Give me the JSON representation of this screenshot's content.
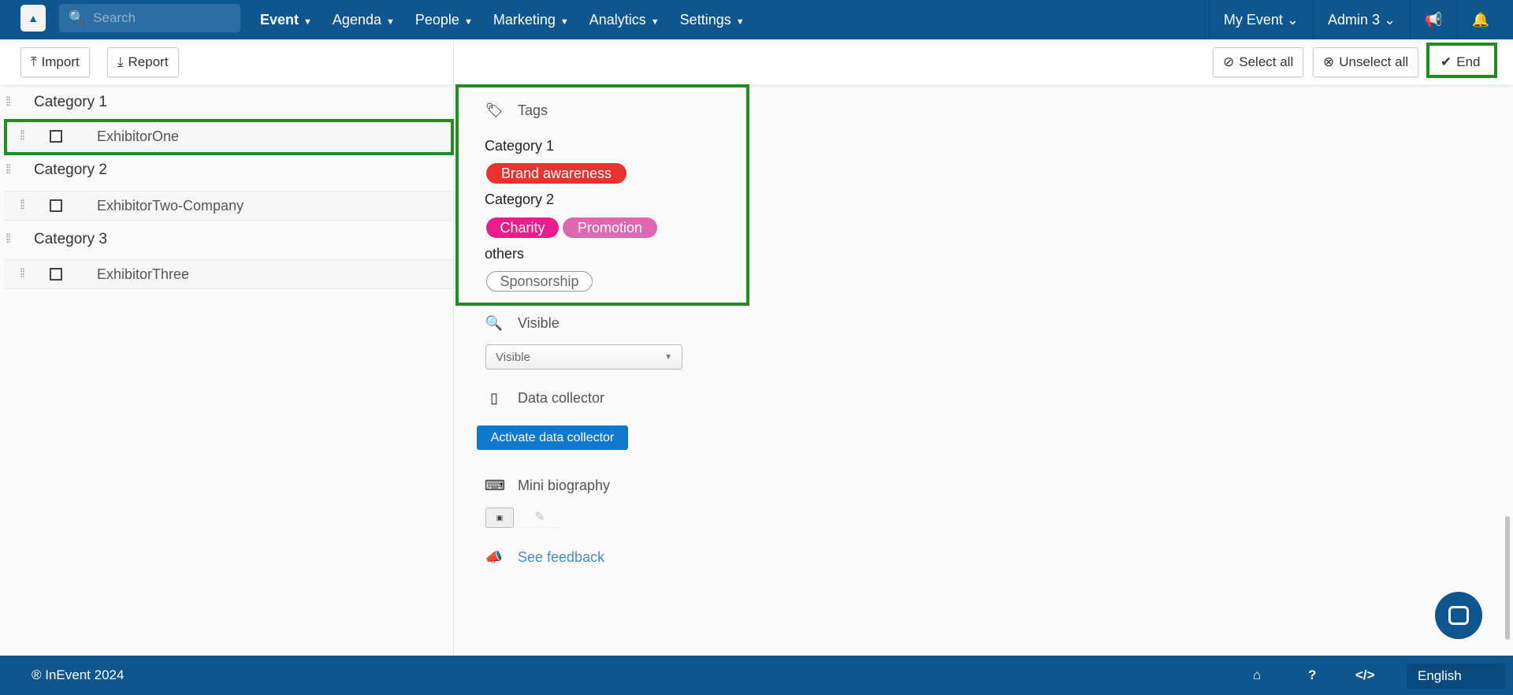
{
  "nav": {
    "search_placeholder": "Search",
    "menus": [
      {
        "label": "Event"
      },
      {
        "label": "Agenda"
      },
      {
        "label": "People"
      },
      {
        "label": "Marketing"
      },
      {
        "label": "Analytics"
      },
      {
        "label": "Settings"
      }
    ],
    "event": "My Event",
    "user": "Admin 3"
  },
  "toolbar": {
    "import": "Import",
    "report": "Report",
    "select_all": "Select all",
    "unselect_all": "Unselect all",
    "end": "End"
  },
  "list": [
    {
      "category": "Category 1",
      "items": [
        "ExhibitorOne"
      ]
    },
    {
      "category": "Category 2",
      "items": [
        "ExhibitorTwo-Company"
      ]
    },
    {
      "category": "Category 3",
      "items": [
        "ExhibitorThree"
      ]
    }
  ],
  "details": {
    "tags_title": "Tags",
    "tag_groups": [
      {
        "name": "Category 1",
        "tags": [
          {
            "label": "Brand awareness",
            "color": "#e8332f"
          }
        ]
      },
      {
        "name": "Category 2",
        "tags": [
          {
            "label": "Charity",
            "color": "#e91e8c"
          },
          {
            "label": "Promotion",
            "color": "#e066b0"
          }
        ]
      },
      {
        "name": "others",
        "tags": [
          {
            "label": "Sponsorship",
            "color": "#ffffff"
          }
        ]
      }
    ],
    "visible_title": "Visible",
    "visible_value": "Visible",
    "data_collector_title": "Data collector",
    "activate_label": "Activate data collector",
    "mini_bio_title": "Mini biography",
    "see_feedback": "See feedback"
  },
  "footer": {
    "copyright": "® InEvent 2024",
    "language": "English"
  },
  "colors": {
    "nav": "#0e5690",
    "highlight": "#228b22",
    "primary_button": "#1079cc"
  }
}
